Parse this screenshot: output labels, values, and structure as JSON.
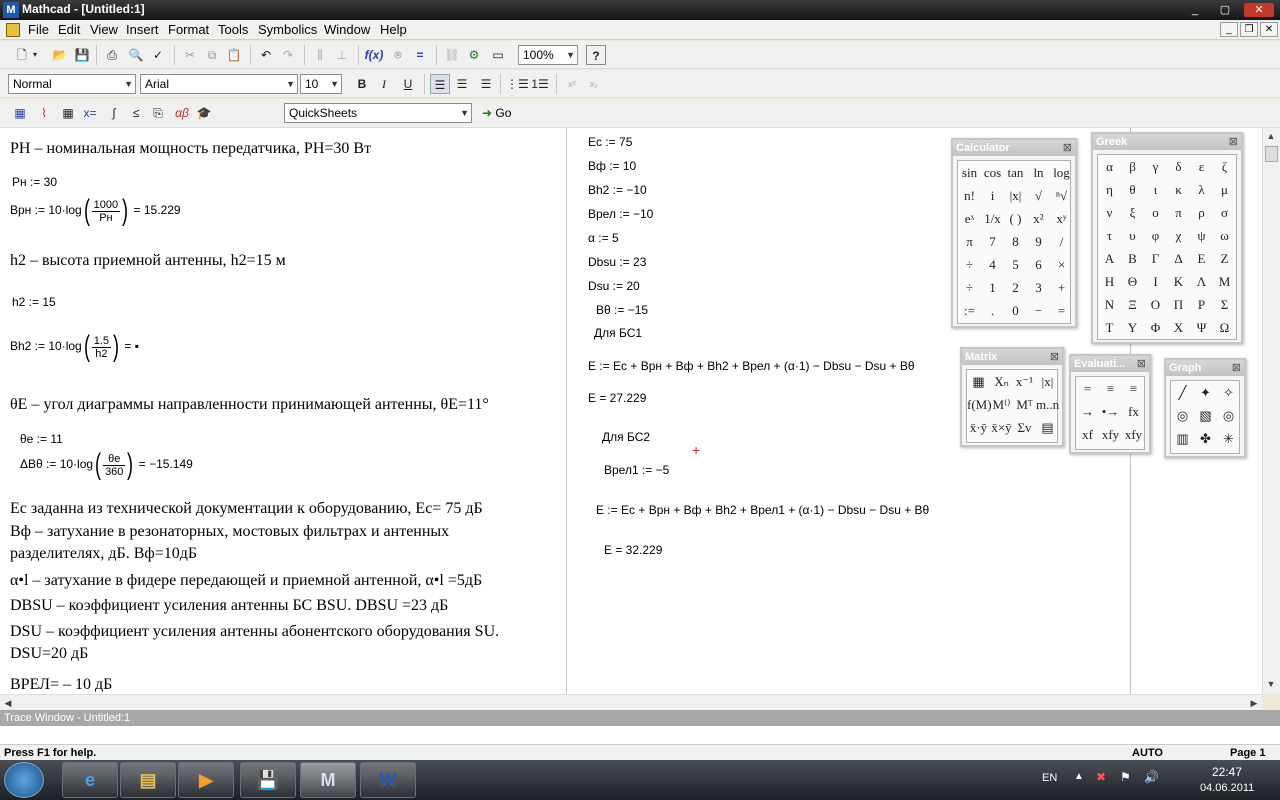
{
  "window": {
    "title": "Mathcad - [Untitled:1]",
    "app_icon": "M",
    "min": "_",
    "max": "▢",
    "close": "✕"
  },
  "menu": [
    "File",
    "Edit",
    "View",
    "Insert",
    "Format",
    "Tools",
    "Symbolics",
    "Window",
    "Help"
  ],
  "toolbar": {
    "zoom": "100%",
    "style": "Normal",
    "font": "Arial",
    "size": "10",
    "quicksheets": "QuickSheets",
    "go": "Go"
  },
  "left_col": {
    "t1": "PН – номинальная мощность передатчика, PН=30 Вт",
    "m1": "Pн := 30",
    "m2a": "Bрн := 10·log",
    "m2num": "1000",
    "m2den": "Pн",
    "m2res": "= 15.229",
    "t2": "h2 – высота приемной антенны, h2=15 м",
    "m3": "h2 := 15",
    "m4a": "Bh2 := 10·log",
    "m4num": "1.5",
    "m4den": "h2",
    "m4res": "= ▪",
    "t3": "θE – угол диаграммы направленности принимающей антенны, θE=11°",
    "m5": "θe := 11",
    "m6a": "ΔBθ := 10·log",
    "m6num": "θe",
    "m6den": "360",
    "m6res": "= −15.149",
    "t4": "Ec заданна из технической документации к оборудованию, Ec= 75 дБ",
    "t5": "Bф – затухание в резонаторных, мостовых фильтрах и антенных",
    "t5b": "разделителях, дБ. Bф=10дБ",
    "t6": "α•l – затухание в фидере передающей и приемной антенной, α•l =5дБ",
    "t7": "DBSU – коэффициент усиления антенны БС BSU. DBSU =23 дБ",
    "t8": "DSU – коэффициент усиления антенны абонентского оборудования SU.",
    "t8b": "DSU=20 дБ",
    "t9": "BРЕЛ= – 10 дБ"
  },
  "right_col": {
    "r1": "Ec := 75",
    "r2": "Bф := 10",
    "r3": "Bh2 := −10",
    "r4": "Bрел := −10",
    "r5": "α := 5",
    "r6": "Dbsu := 23",
    "r7": "Dsu := 20",
    "r8": "Bθ := −15",
    "r9": "Для БС1",
    "r10": "E := Ec + Bрн + Bф + Bh2 + Bрел + (α·1) − Dbsu − Dsu + Bθ",
    "r11": "E = 27.229",
    "r12": "Для БС2",
    "r13": "Bрел1 := −5",
    "r14": "E := Ec + Bрн + Bф + Bh2 + Bрел1 + (α·1) − Dbsu − Dsu + Bθ",
    "r15": "E = 32.229"
  },
  "palettes": {
    "calculator": {
      "title": "Calculator",
      "keys": [
        "sin",
        "cos",
        "tan",
        "ln",
        "log",
        "n!",
        "i",
        "|x|",
        "√",
        "ⁿ√",
        "eˣ",
        "1/x",
        "( )",
        "x²",
        "xʸ",
        "π",
        "7",
        "8",
        "9",
        "/",
        "÷",
        "4",
        "5",
        "6",
        "×",
        "÷",
        "1",
        "2",
        "3",
        "+",
        ":=",
        ".",
        "0",
        "−",
        "="
      ]
    },
    "greek": {
      "title": "Greek",
      "keys": [
        "α",
        "β",
        "γ",
        "δ",
        "ε",
        "ζ",
        "η",
        "θ",
        "ι",
        "κ",
        "λ",
        "μ",
        "ν",
        "ξ",
        "ο",
        "π",
        "ρ",
        "σ",
        "τ",
        "υ",
        "φ",
        "χ",
        "ψ",
        "ω",
        "Α",
        "Β",
        "Γ",
        "Δ",
        "Ε",
        "Ζ",
        "Η",
        "Θ",
        "Ι",
        "Κ",
        "Λ",
        "Μ",
        "Ν",
        "Ξ",
        "Ο",
        "Π",
        "Ρ",
        "Σ",
        "Τ",
        "Υ",
        "Φ",
        "Χ",
        "Ψ",
        "Ω"
      ]
    },
    "matrix": {
      "title": "Matrix",
      "keys": [
        "▦",
        "Xₙ",
        "x⁻¹",
        "|x|",
        "f(M)",
        "M⁽⁾",
        "Mᵀ",
        "m..n",
        "x̄·ȳ",
        "x̄×ȳ",
        "Σv",
        "▤"
      ]
    },
    "evaluation": {
      "title": "Evaluati...",
      "keys": [
        "=",
        "≡",
        "≡",
        "→",
        "•→",
        "fx",
        "xf",
        "xfy",
        "xfy"
      ]
    },
    "graph": {
      "title": "Graph",
      "keys": [
        "╱",
        "✦",
        "✧",
        "◎",
        "▧",
        "◎",
        "▥",
        "✤",
        "✳"
      ]
    }
  },
  "trace": {
    "title": "Trace Window - Untitled:1"
  },
  "status": {
    "help": "Press F1 for help.",
    "mode": "AUTO",
    "page": "Page 1"
  },
  "taskbar": {
    "lang": "EN",
    "time": "22:47",
    "date": "04.06.2011"
  }
}
